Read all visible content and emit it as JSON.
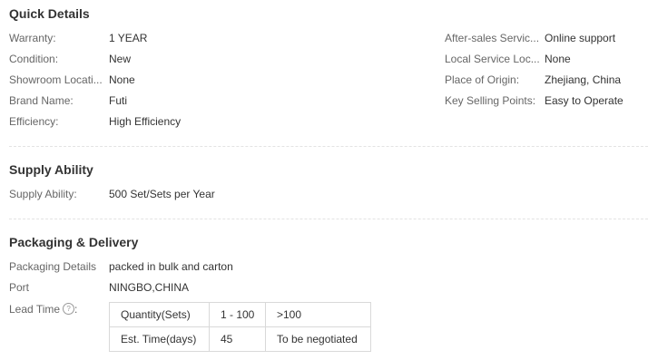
{
  "quick_details": {
    "title": "Quick Details",
    "left": [
      {
        "label": "Warranty:",
        "value": "1 YEAR"
      },
      {
        "label": "Condition:",
        "value": "New"
      },
      {
        "label": "Showroom Locati...",
        "value": "None"
      },
      {
        "label": "Brand Name:",
        "value": "Futi"
      },
      {
        "label": "Efficiency:",
        "value": "High Efficiency"
      }
    ],
    "right": [
      {
        "label": "After-sales Servic...",
        "value": "Online support"
      },
      {
        "label": "Local Service Loc...",
        "value": "None"
      },
      {
        "label": "Place of Origin:",
        "value": "Zhejiang, China"
      },
      {
        "label": "Key Selling Points:",
        "value": "Easy to Operate"
      }
    ]
  },
  "supply": {
    "title": "Supply Ability",
    "label": "Supply Ability:",
    "value": "500 Set/Sets per Year"
  },
  "packaging": {
    "title": "Packaging & Delivery",
    "details_label": "Packaging Details",
    "details_value": "packed in bulk and carton",
    "port_label": "Port",
    "port_value": "NINGBO,CHINA",
    "lead_time_label": "Lead Time",
    "help_icon": "?",
    "table": {
      "header": [
        "Quantity(Sets)",
        "1 - 100",
        ">100"
      ],
      "row": [
        "Est. Time(days)",
        "45",
        "To be negotiated"
      ]
    }
  }
}
